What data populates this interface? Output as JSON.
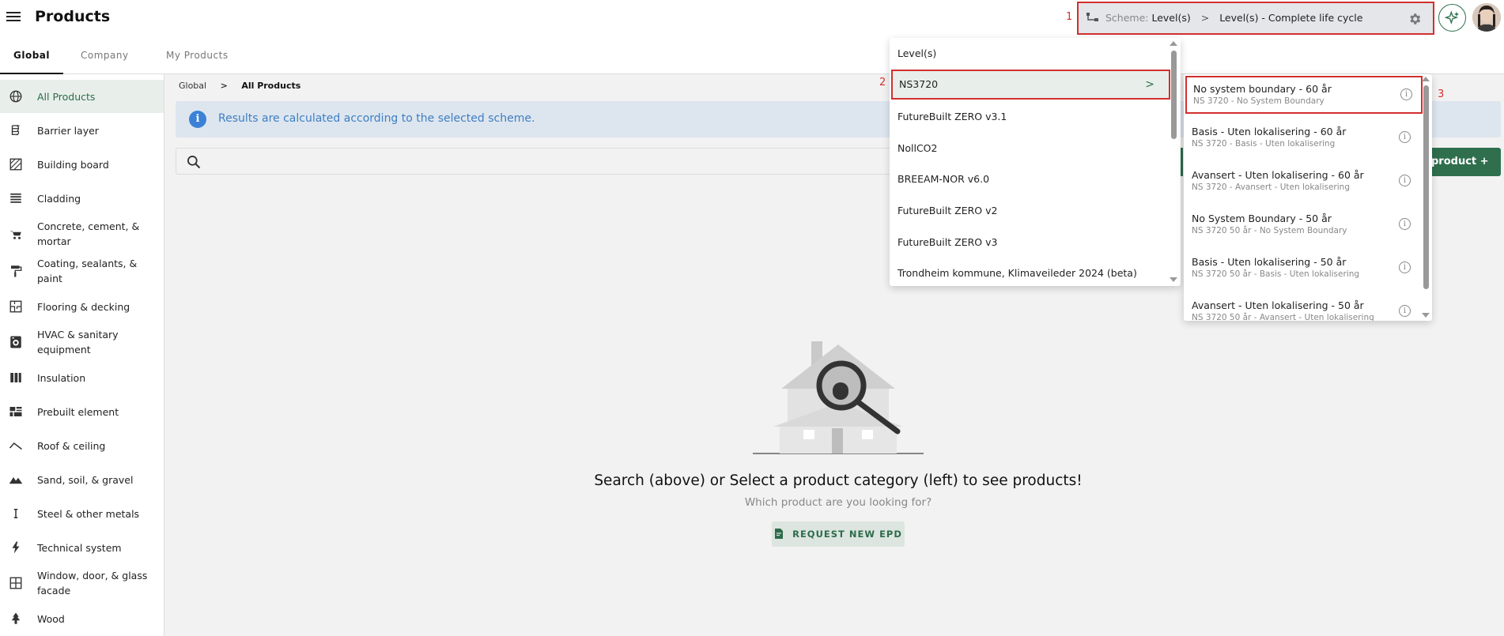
{
  "header": {
    "title": "Products"
  },
  "tabs": [
    {
      "label": "Global"
    },
    {
      "label": "Company"
    },
    {
      "label": "My Products"
    }
  ],
  "sidebar": {
    "items": [
      {
        "label": "All Products",
        "icon": "globe-icon"
      },
      {
        "label": "Barrier layer",
        "icon": "barrier-layer-icon"
      },
      {
        "label": "Building board",
        "icon": "building-board-icon"
      },
      {
        "label": "Cladding",
        "icon": "cladding-icon"
      },
      {
        "label": "Concrete, cement, & mortar",
        "icon": "wheelbarrow-icon"
      },
      {
        "label": "Coating, sealants, & paint",
        "icon": "paint-roller-icon"
      },
      {
        "label": "Flooring & decking",
        "icon": "floorplan-icon"
      },
      {
        "label": "HVAC & sanitary equipment",
        "icon": "hvac-icon"
      },
      {
        "label": "Insulation",
        "icon": "insulation-icon"
      },
      {
        "label": "Prebuilt element",
        "icon": "prebuilt-icon"
      },
      {
        "label": "Roof & ceiling",
        "icon": "roof-icon"
      },
      {
        "label": "Sand, soil, & gravel",
        "icon": "mountain-icon"
      },
      {
        "label": "Steel & other metals",
        "icon": "i-beam-icon"
      },
      {
        "label": "Technical system",
        "icon": "lightning-icon"
      },
      {
        "label": "Window, door, & glass facade",
        "icon": "window-icon"
      },
      {
        "label": "Wood",
        "icon": "tree-icon"
      }
    ]
  },
  "breadcrumb": {
    "root": "Global",
    "sep": ">",
    "current": "All Products"
  },
  "info_banner": {
    "icon_char": "i",
    "text": "Results are calculated according to the selected scheme."
  },
  "add_product": {
    "label": "product +"
  },
  "empty_state": {
    "title": "Search (above) or Select a product category (left) to see products!",
    "subtitle": "Which product are you looking for?",
    "button": "REQUEST NEW EPD"
  },
  "scheme": {
    "prefix": "Scheme:",
    "level": "Level(s)",
    "sep": ">",
    "selection": "Level(s) - Complete life cycle"
  },
  "annotations": {
    "a1": "1",
    "a2": "2",
    "a3": "3"
  },
  "scheme_menu": {
    "items": [
      {
        "label": "Level(s)"
      },
      {
        "label": "NS3720",
        "has_submenu": true,
        "chevron": ">"
      },
      {
        "label": "FutureBuilt ZERO v3.1"
      },
      {
        "label": "NollCO2"
      },
      {
        "label": "BREEAM-NOR v6.0"
      },
      {
        "label": "FutureBuilt ZERO v2"
      },
      {
        "label": "FutureBuilt ZERO v3"
      },
      {
        "label": "Trondheim kommune, Klimaveileder 2024 (beta)"
      }
    ]
  },
  "sub_menu": {
    "info_char": "i",
    "items": [
      {
        "title": "No system boundary - 60 år",
        "sub": "NS 3720 - No System Boundary"
      },
      {
        "title": "Basis - Uten lokalisering - 60 år",
        "sub": "NS 3720 - Basis - Uten lokalisering"
      },
      {
        "title": "Avansert - Uten lokalisering - 60 år",
        "sub": "NS 3720 - Avansert - Uten lokalisering"
      },
      {
        "title": "No System Boundary - 50 år",
        "sub": "NS 3720 50 år - No System Boundary"
      },
      {
        "title": "Basis - Uten lokalisering - 50 år",
        "sub": "NS 3720 50 år - Basis - Uten lokalisering"
      },
      {
        "title": "Avansert - Uten lokalisering - 50 år",
        "sub": "NS 3720 50 år - Avansert - Uten lokalisering"
      }
    ]
  },
  "colors": {
    "accent": "#2f6f4e",
    "highlight": "#d32f2f",
    "info": "#3b82d6"
  }
}
